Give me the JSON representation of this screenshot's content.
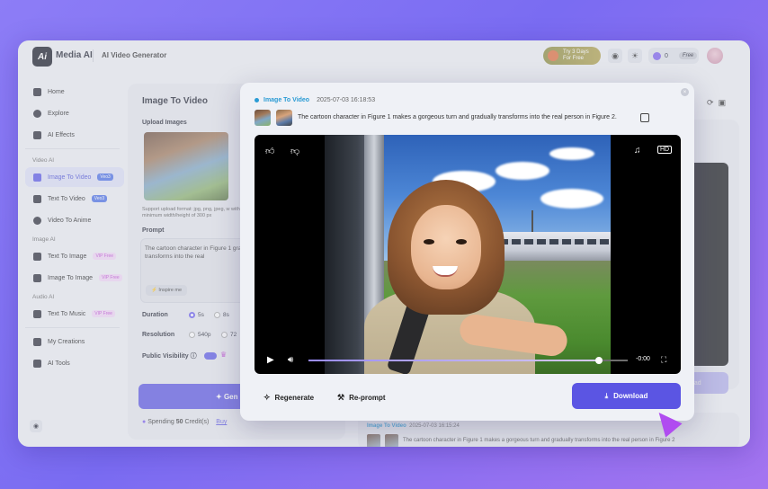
{
  "header": {
    "logo": "Ai",
    "brand": "Media AI",
    "app_title": "AI Video Generator",
    "trial_line1": "Try 3 Days",
    "trial_line2": "For Free",
    "credits_count": "0",
    "free_badge": "Free"
  },
  "sidebar": {
    "items": [
      {
        "label": "Home",
        "icon": "home-icon"
      },
      {
        "label": "Explore",
        "icon": "compass-icon"
      },
      {
        "label": "AI Effects",
        "icon": "sparkles-icon"
      }
    ],
    "sections": [
      {
        "title": "Video AI",
        "items": [
          {
            "label": "Image To Video",
            "badge": "Veo3",
            "active": true
          },
          {
            "label": "Text To Video",
            "badge": "Veo3"
          },
          {
            "label": "Video To Anime",
            "badge": ""
          }
        ]
      },
      {
        "title": "Image AI",
        "items": [
          {
            "label": "Text To Image",
            "badge": "VIP Free"
          },
          {
            "label": "Image To Image",
            "badge": "VIP Free"
          }
        ]
      },
      {
        "title": "Audio AI",
        "items": [
          {
            "label": "Text To Music",
            "badge": "VIP Free"
          }
        ]
      }
    ],
    "bottom_items": [
      {
        "label": "My Creations"
      },
      {
        "label": "AI Tools"
      }
    ]
  },
  "form": {
    "title": "Image To Video",
    "upload_label": "Upload Images",
    "support_text": "Support upload format: jpg, png, jpeg, w with a minimum width/height of 300 px",
    "prompt_label": "Prompt",
    "prompt_value": "The cartoon character in Figure 1 gradually transforms into the real",
    "inspire_label": "Inspire me",
    "duration_label": "Duration",
    "duration_opt1": "5s",
    "duration_opt2": "8s",
    "resolution_label": "Resolution",
    "resolution_opt1": "540p",
    "resolution_opt2": "72",
    "visibility_label": "Public Visibility",
    "generate_label": "Gen",
    "spending_prefix": "Spending",
    "spending_amount": "50",
    "spending_suffix": "Credit(s)",
    "buy_label": "Buy"
  },
  "right": {
    "download_label": "oad",
    "card2_type": "Image To Video",
    "card2_date": "2025-07-03 16:15:24",
    "card2_prompt": "The cartoon character in Figure 1 makes a gorgeous turn and gradually transforms into the real person in Figure 2"
  },
  "modal": {
    "type": "Image To Video",
    "date": "2025-07-03 16:18:53",
    "prompt": "The cartoon character in Figure 1 makes a gorgeous turn and gradually transforms into the real person in Figure 2.",
    "player": {
      "time": "-0:00",
      "progress": 0.91
    },
    "regenerate_label": "Regenerate",
    "reprompt_label": "Re-prompt",
    "download_label": "Download"
  },
  "colors": {
    "accent": "#5b55e3",
    "type_blue": "#2a9bd4"
  }
}
